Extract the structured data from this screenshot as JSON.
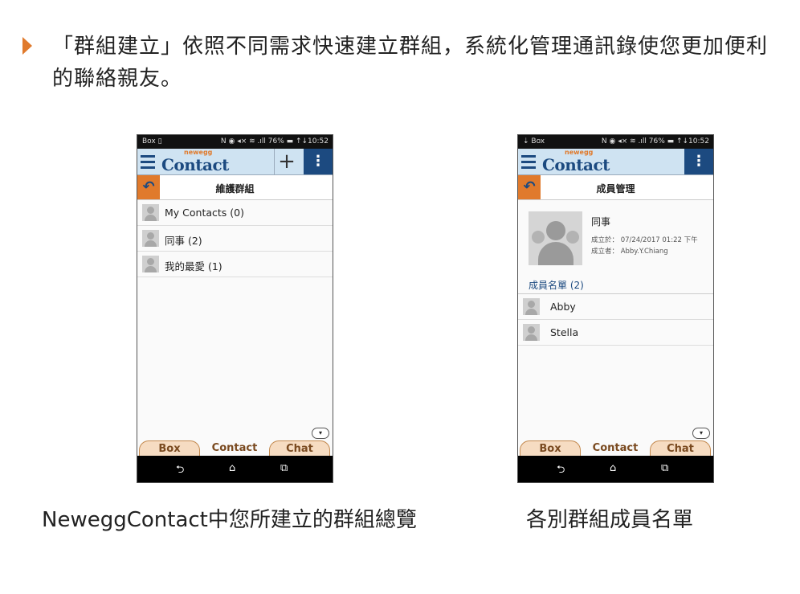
{
  "headline": "「群組建立」依照不同需求快速建立群組，系統化管理通訊錄使您更加便利的聯絡親友。",
  "phone1": {
    "status_left": "Box ▯",
    "status_right": "N ◉ ◂× ≋ .ıll 76% ▬  ↑↓10:52",
    "logo": "Contact",
    "logo_small": "newegg",
    "title": "維護群組",
    "groups": [
      {
        "label": "My Contacts (0)"
      },
      {
        "label": "同事 (2)"
      },
      {
        "label": "我的最愛 (1)"
      }
    ],
    "tabs": [
      "Box",
      "Contact",
      "Chat"
    ],
    "caption": "NeweggContact中您所建立的群組總覽"
  },
  "phone2": {
    "status_left": "⇣ Box",
    "status_right": "N ◉ ◂× ≋ .ıll 76% ▬  ↑↓10:52",
    "logo": "Contact",
    "logo_small": "newegg",
    "title": "成員管理",
    "group_name": "同事",
    "created_on": "成立於：  07/24/2017 01:22 下午",
    "created_by": "成立者：  Abby.Y.Chiang",
    "member_section": "成員名單 (2)",
    "members": [
      {
        "name": "Abby"
      },
      {
        "name": "Stella"
      }
    ],
    "tabs": [
      "Box",
      "Contact",
      "Chat"
    ],
    "caption": "各別群組成員名單"
  },
  "icons": {
    "plus": "+",
    "more": "⋮",
    "back": "↶",
    "collapse": "▾",
    "nav_back": "⮌",
    "nav_home": "⌂",
    "nav_recent": "⧉"
  },
  "colors": {
    "accent": "#e07a2c",
    "brand": "#1c4a80",
    "appbar": "#cfe3f2"
  }
}
